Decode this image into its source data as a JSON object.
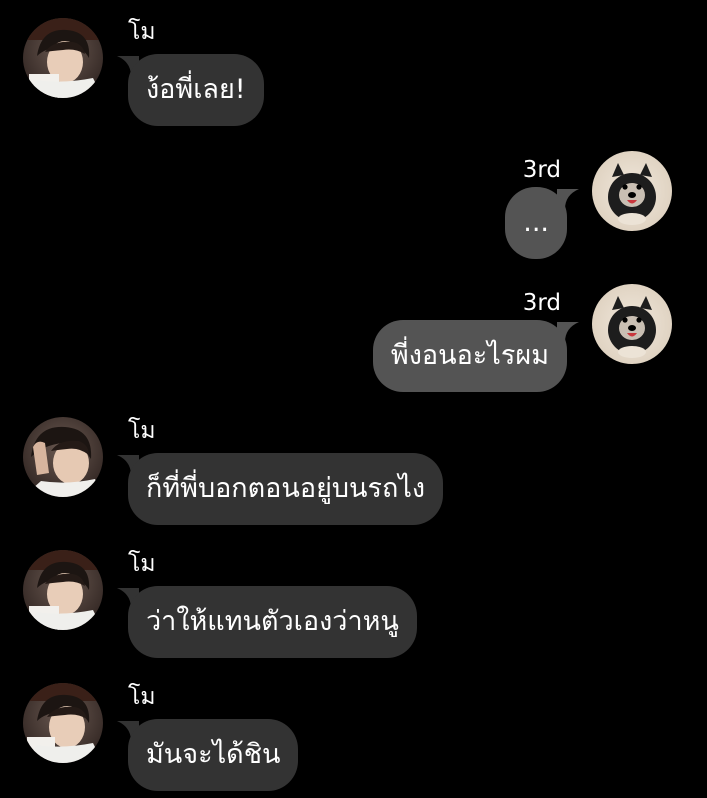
{
  "theme": {
    "background": "#000000",
    "incoming_bubble": "#333333",
    "outgoing_bubble": "#545454",
    "text": "#ffffff"
  },
  "messages": [
    {
      "direction": "incoming",
      "sender": "โม",
      "text": "ง้อพี่เลย!",
      "avatar": "boy-avatar"
    },
    {
      "direction": "outgoing",
      "sender": "3rd",
      "text": "...",
      "avatar": "puppy-avatar"
    },
    {
      "direction": "outgoing",
      "sender": "3rd",
      "text": "พี่งอนอะไรผม",
      "avatar": "puppy-avatar"
    },
    {
      "direction": "incoming",
      "sender": "โม",
      "text": "ก็ที่พี่บอกตอนอยู่บนรถไง",
      "avatar": "boy-avatar"
    },
    {
      "direction": "incoming",
      "sender": "โม",
      "text": "ว่าให้แทนตัวเองว่าหนู",
      "avatar": "boy-avatar"
    },
    {
      "direction": "incoming",
      "sender": "โม",
      "text": "มันจะได้ชิน",
      "avatar": "boy-avatar"
    }
  ]
}
